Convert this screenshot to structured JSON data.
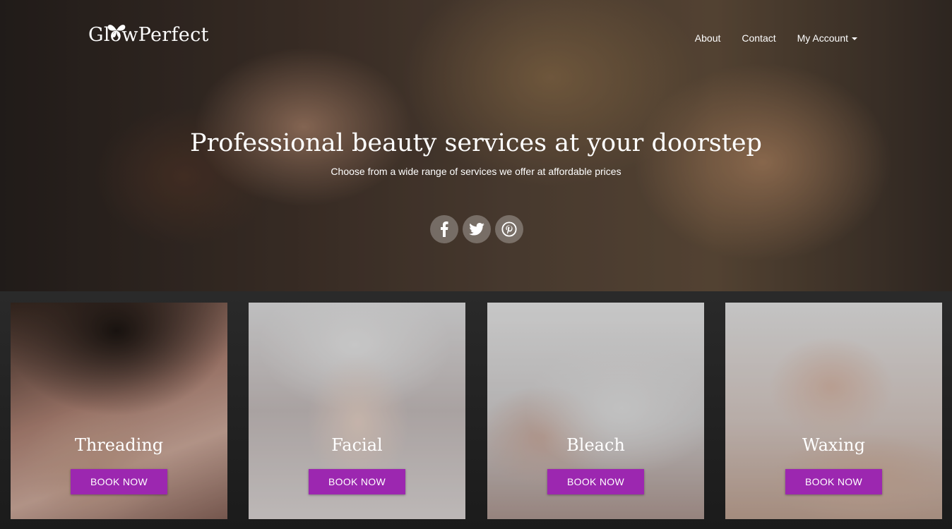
{
  "brand": {
    "name": "GlowPerfect",
    "logo_icon": "butterfly-icon"
  },
  "nav": {
    "items": [
      {
        "label": "About"
      },
      {
        "label": "Contact"
      },
      {
        "label": "My Account",
        "has_dropdown": true
      }
    ]
  },
  "hero": {
    "title": "Professional beauty services at your doorstep",
    "subtitle": "Choose from a wide range of services we offer at affordable prices"
  },
  "social": [
    {
      "icon": "facebook-icon"
    },
    {
      "icon": "twitter-icon"
    },
    {
      "icon": "pinterest-icon"
    }
  ],
  "services": [
    {
      "name": "Threading",
      "button": "BOOK NOW"
    },
    {
      "name": "Facial",
      "button": "BOOK NOW"
    },
    {
      "name": "Bleach",
      "button": "BOOK NOW"
    },
    {
      "name": "Waxing",
      "button": "BOOK NOW"
    }
  ],
  "colors": {
    "accent": "#9c27b0",
    "services_background": "#1c1c1c",
    "text": "#ffffff"
  }
}
